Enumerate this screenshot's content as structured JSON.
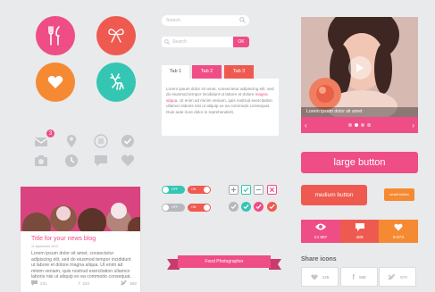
{
  "colors": {
    "pink": "#ef4d86",
    "coral": "#ef5a50",
    "orange": "#f58a32",
    "teal": "#34c6b3",
    "background": "#e9eaec"
  },
  "round_icons": [
    "cutlery-icon",
    "bow-icon",
    "heart-icon",
    "deer-icon"
  ],
  "grey_icons": [
    "mail-icon",
    "location-pin-icon",
    "menu-icon",
    "check-circle-icon",
    "camera-icon",
    "clock-icon",
    "chat-icon",
    "heart-icon"
  ],
  "mail_badge": "3",
  "news": {
    "title": "Title for your news blog",
    "date": "11 septembre 2013",
    "text": "Lorem ipsum dolor sit amet, consectetur adipiscing elit, sed do eiusmod tempor incididunt ut labore et dolore magna aliqua. Ut enim ad minim veniam, quis nostrud exercitation ullamco laboris nisi ut aliquip ex ea commodo consequat.",
    "comments": "231",
    "facebook": "234",
    "twitter": "562"
  },
  "search": {
    "placeholder_1": "Search",
    "placeholder_2": "Search",
    "ok_label": "OK"
  },
  "tabs": {
    "items": [
      "Tab 1",
      "Tab 2",
      "Tab 3"
    ],
    "active": "Tab 1",
    "body_1": "Lorem ipsum dolor sit amet, consectetur adipiscing elit, sed do eiusmod tempor incididunt ut labore et dolore ",
    "body_link": "magna aliqua",
    "body_2": ". Ut enim ad minim veniam, quis nostrud exercitation ullamco laboris nisi ut aliquip ex ea commodo consequat. Duis aute irure dolor in reprehenderit."
  },
  "toggles": {
    "on_label": "OFF",
    "on_label_2": "ON",
    "off_label": "OFF",
    "off_label_2": "ON"
  },
  "video": {
    "caption": "Lorem ipsum dolor sit amet",
    "slides": 4,
    "active_slide": 2
  },
  "buttons": {
    "large": "large button",
    "medium": "medium button",
    "small": "small button"
  },
  "stats": [
    {
      "icon": "eye-icon",
      "value": "24 987"
    },
    {
      "icon": "comment-icon",
      "value": "489"
    },
    {
      "icon": "heart-icon",
      "value": "9 873"
    }
  ],
  "ribbon": "Food Photographer",
  "share": {
    "label": "Share icons",
    "items": [
      {
        "icon": "heart-icon",
        "count": "125"
      },
      {
        "icon": "facebook-icon",
        "count": "936"
      },
      {
        "icon": "twitter-icon",
        "count": "674"
      }
    ]
  }
}
